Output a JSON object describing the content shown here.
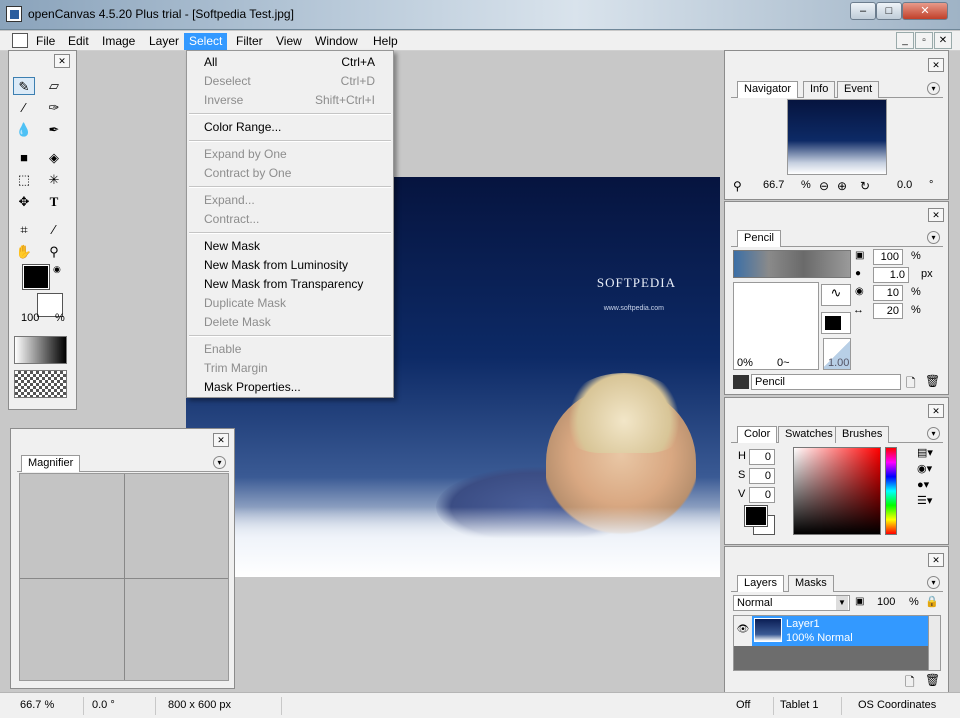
{
  "window": {
    "title": "openCanvas 4.5.20 Plus trial - [Softpedia Test.jpg]",
    "minimize": "–",
    "maximize": "□",
    "close": "✕"
  },
  "menubar": {
    "items": [
      "File",
      "Edit",
      "Image",
      "Layer",
      "Select",
      "Filter",
      "View",
      "Window",
      "Help"
    ],
    "active": "Select"
  },
  "select_menu": {
    "groups": [
      [
        {
          "label": "All",
          "shortcut": "Ctrl+A",
          "enabled": true
        },
        {
          "label": "Deselect",
          "shortcut": "Ctrl+D",
          "enabled": false
        },
        {
          "label": "Inverse",
          "shortcut": "Shift+Ctrl+I",
          "enabled": false
        }
      ],
      [
        {
          "label": "Color Range...",
          "shortcut": "",
          "enabled": true
        }
      ],
      [
        {
          "label": "Expand by One",
          "shortcut": "",
          "enabled": false
        },
        {
          "label": "Contract by One",
          "shortcut": "",
          "enabled": false
        }
      ],
      [
        {
          "label": "Expand...",
          "shortcut": "",
          "enabled": false
        },
        {
          "label": "Contract...",
          "shortcut": "",
          "enabled": false
        }
      ],
      [
        {
          "label": "New Mask",
          "shortcut": "",
          "enabled": true
        },
        {
          "label": "New Mask from Luminosity",
          "shortcut": "",
          "enabled": true
        },
        {
          "label": "New Mask from Transparency",
          "shortcut": "",
          "enabled": true
        },
        {
          "label": "Duplicate Mask",
          "shortcut": "",
          "enabled": false
        },
        {
          "label": "Delete Mask",
          "shortcut": "",
          "enabled": false
        }
      ],
      [
        {
          "label": "Enable",
          "shortcut": "",
          "enabled": false
        },
        {
          "label": "Trim Margin",
          "shortcut": "",
          "enabled": false
        },
        {
          "label": "Mask Properties...",
          "shortcut": "",
          "enabled": true
        }
      ]
    ]
  },
  "canvas": {
    "brand": "SOFTPEDIA",
    "url": "www.softpedia.com"
  },
  "toolbox": {
    "opacity": "100",
    "opacity_unit": "%"
  },
  "magnifier": {
    "tab": "Magnifier"
  },
  "navigator": {
    "tabs": [
      "Navigator",
      "Info",
      "Event"
    ],
    "zoom": "66.7",
    "zoom_unit": "%",
    "angle": "0.0",
    "angle_unit": "°"
  },
  "pencil": {
    "tab": "Pencil",
    "opacity": "100",
    "opacity_unit": "%",
    "size": "1.0",
    "size_unit": "px",
    "density": "10",
    "density_unit": "%",
    "spacing": "20",
    "spacing_unit": "%",
    "preview_left": "0%",
    "preview_mid": "0~",
    "preview_right": "1.00",
    "brush_name": "Pencil"
  },
  "color": {
    "tabs": [
      "Color",
      "Swatches",
      "Brushes"
    ],
    "h_label": "H",
    "h": "0",
    "s_label": "S",
    "s": "0",
    "v_label": "V",
    "v": "0"
  },
  "layers": {
    "tabs": [
      "Layers",
      "Masks"
    ],
    "blend_mode": "Normal",
    "opacity": "100",
    "opacity_unit": "%",
    "layer_name": "Layer1",
    "layer_info": "100% Normal"
  },
  "statusbar": {
    "zoom": "66.7 %",
    "angle": "0.0 °",
    "size": "800 x 600 px",
    "state": "Off",
    "tablet": "Tablet 1",
    "coords": "OS Coordinates"
  },
  "colors": {
    "accent": "#3399ff",
    "canvas_top": "#06143f",
    "foreground": "#000000",
    "background": "#ffffff"
  }
}
